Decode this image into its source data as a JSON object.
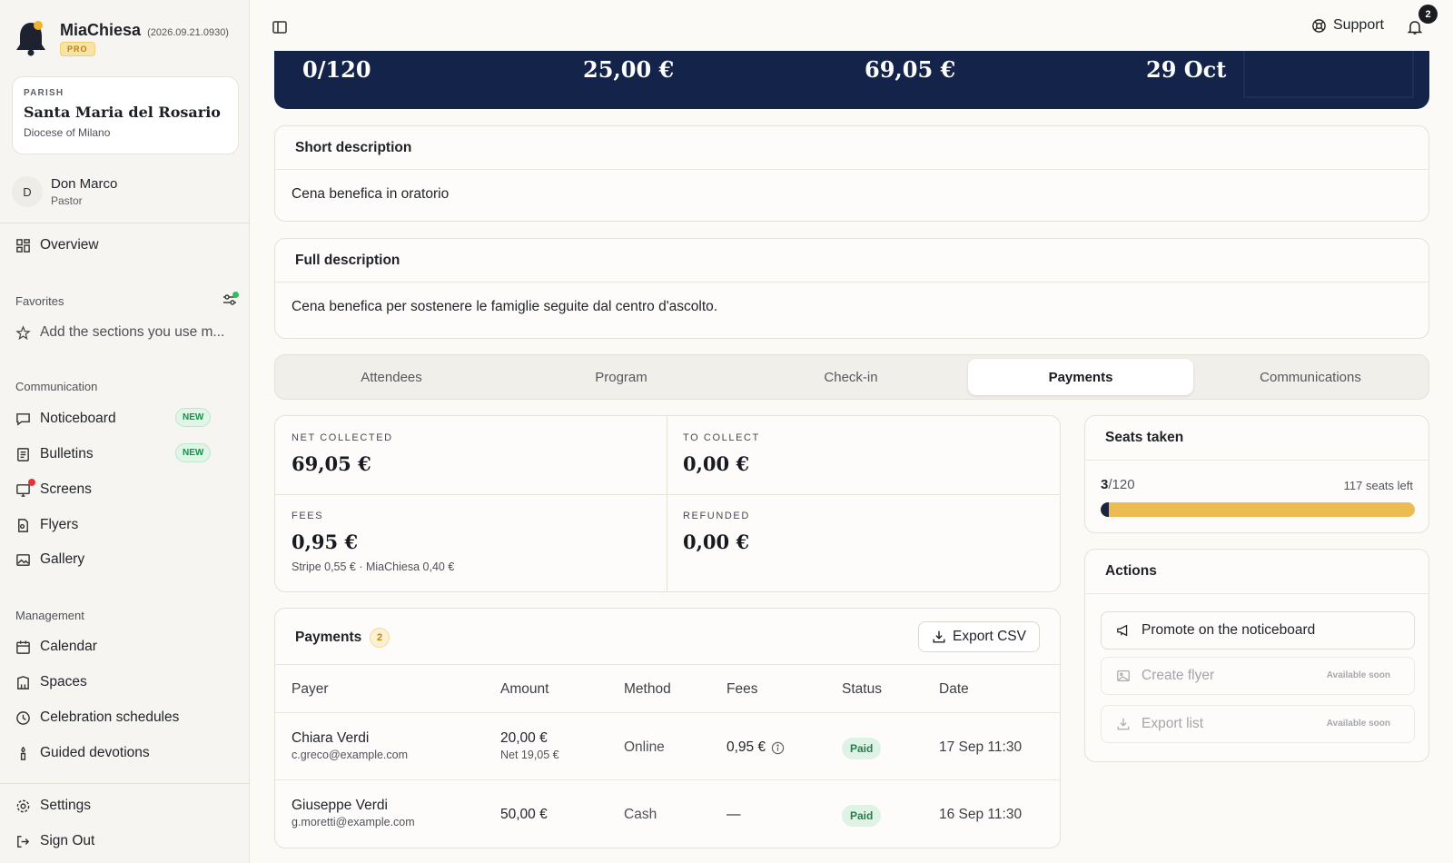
{
  "brand": {
    "name": "MiaChiesa",
    "version": "(2026.09.21.0930)",
    "tier": "PRO"
  },
  "parish": {
    "kicker": "PARISH",
    "name": "Santa Maria del Rosario",
    "diocese": "Diocese of Milano"
  },
  "user": {
    "initial": "D",
    "name": "Don Marco",
    "role": "Pastor"
  },
  "nav": {
    "overview": "Overview",
    "favorites_label": "Favorites",
    "favorites_hint": "Add the sections you use m...",
    "communication_label": "Communication",
    "noticeboard": "Noticeboard",
    "bulletins": "Bulletins",
    "screens": "Screens",
    "flyers": "Flyers",
    "gallery": "Gallery",
    "new_badge": "NEW",
    "management_label": "Management",
    "calendar": "Calendar",
    "spaces": "Spaces",
    "celebration": "Celebration schedules",
    "devotions": "Guided devotions",
    "settings": "Settings",
    "signout": "Sign Out"
  },
  "header": {
    "support": "Support",
    "notifications": "2"
  },
  "hero": {
    "seats": "0/120",
    "price": "25,00 €",
    "collected": "69,05 €",
    "date": "29 Oct"
  },
  "short_desc": {
    "title": "Short description",
    "text": "Cena benefica in oratorio"
  },
  "full_desc": {
    "title": "Full description",
    "text": "Cena benefica per sostenere le famiglie seguite dal centro d'ascolto."
  },
  "tabs": [
    "Attendees",
    "Program",
    "Check-in",
    "Payments",
    "Communications"
  ],
  "stats": {
    "net_label": "NET COLLECTED",
    "net_value": "69,05 €",
    "collect_label": "TO COLLECT",
    "collect_value": "0,00 €",
    "fees_label": "FEES",
    "fees_value": "0,95 €",
    "fees_detail": "Stripe 0,55 € · MiaChiesa 0,40 €",
    "refunded_label": "REFUNDED",
    "refunded_value": "0,00 €"
  },
  "payments": {
    "title": "Payments",
    "count": "2",
    "export": "Export CSV",
    "columns": [
      "Payer",
      "Amount",
      "Method",
      "Fees",
      "Status",
      "Date"
    ],
    "rows": [
      {
        "name": "Chiara Verdi",
        "email": "c.greco@example.com",
        "amount": "20,00 €",
        "net": "Net 19,05 €",
        "method": "Online",
        "fees": "0,95 €",
        "status": "Paid",
        "date": "17 Sep 11:30"
      },
      {
        "name": "Giuseppe Verdi",
        "email": "g.moretti@example.com",
        "amount": "50,00 €",
        "net": "",
        "method": "Cash",
        "fees": "—",
        "status": "Paid",
        "date": "16 Sep 11:30"
      }
    ]
  },
  "seats": {
    "title": "Seats taken",
    "taken": "3",
    "total": "/120",
    "left": "117 seats left",
    "fraction": 0.025
  },
  "actions": {
    "title": "Actions",
    "promote": "Promote on the noticeboard",
    "flyer": "Create flyer",
    "export_list": "Export list",
    "soon": "Available soon"
  },
  "colors": {
    "navy": "#14234a",
    "accent": "#ecbc52",
    "success": "#2b7a4b"
  }
}
